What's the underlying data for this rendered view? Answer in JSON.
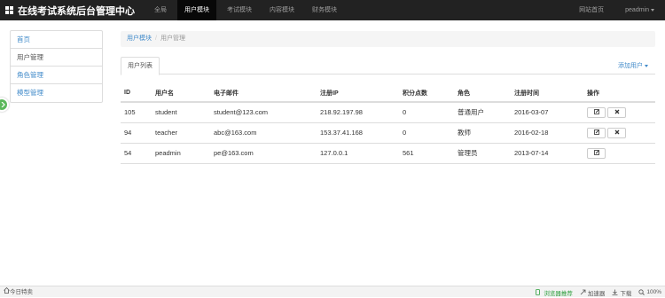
{
  "navbar": {
    "brand": "在线考试系统后台管理中心",
    "items": [
      {
        "label": "全局",
        "active": false
      },
      {
        "label": "用户模块",
        "active": true
      },
      {
        "label": "考试模块",
        "active": false
      },
      {
        "label": "内容模块",
        "active": false
      },
      {
        "label": "财务模块",
        "active": false
      }
    ],
    "homepage": "网站首页",
    "user": "peadmin"
  },
  "sidebar": {
    "items": [
      {
        "label": "首页"
      },
      {
        "label": "用户管理"
      },
      {
        "label": "角色管理"
      },
      {
        "label": "模型管理"
      }
    ]
  },
  "breadcrumb": {
    "module": "用户模块",
    "separator": "/",
    "current": "用户管理"
  },
  "tabs": {
    "active": "用户列表",
    "add_user": "添加用户"
  },
  "table": {
    "headers": [
      "ID",
      "用户名",
      "电子邮件",
      "注册IP",
      "积分点数",
      "角色",
      "注册时间",
      "操作"
    ],
    "rows": [
      {
        "id": "105",
        "username": "student",
        "email": "student@123.com",
        "ip": "218.92.197.98",
        "score": "0",
        "role": "普通用户",
        "time": "2016-03-07",
        "deletable": true
      },
      {
        "id": "94",
        "username": "teacher",
        "email": "abc@163.com",
        "ip": "153.37.41.168",
        "score": "0",
        "role": "教师",
        "time": "2016-02-18",
        "deletable": true
      },
      {
        "id": "54",
        "username": "peadmin",
        "email": "pe@163.com",
        "ip": "127.0.0.1",
        "score": "561",
        "role": "管理员",
        "time": "2013-07-14",
        "deletable": false
      }
    ]
  },
  "statusbar": {
    "left": "今日特卖",
    "items": [
      "加速器",
      "下载",
      "100%"
    ],
    "accent": "#2a9d3a",
    "green_label": "浏览器推荐"
  },
  "colors": {
    "navbar": "#222222",
    "link": "#428bca",
    "active_nav": "#080808"
  }
}
